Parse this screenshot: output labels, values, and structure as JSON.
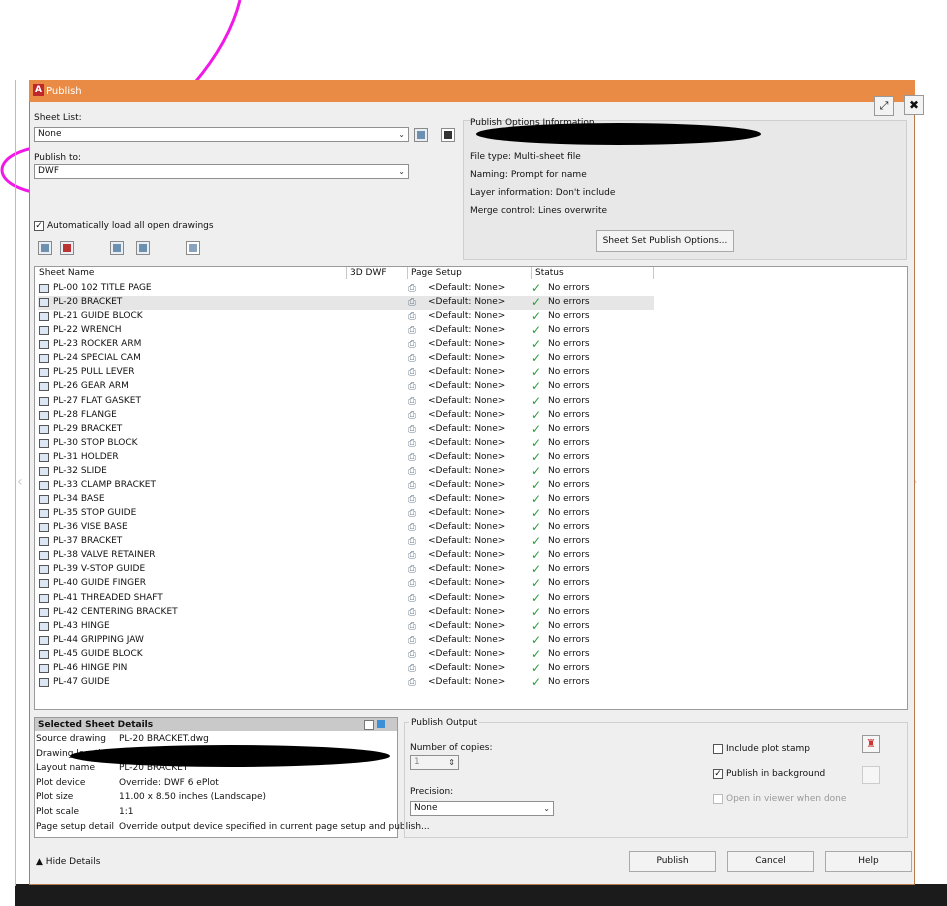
{
  "window": {
    "title": "Publish",
    "app_icon": "A"
  },
  "sheet_list": {
    "label": "Sheet List:",
    "value": "None"
  },
  "publish_to": {
    "label": "Publish to:",
    "value": "DWF"
  },
  "auto_load": {
    "label": "Automatically load all open drawings",
    "checked": true
  },
  "options_info": {
    "heading": "Publish Options Information",
    "lines": [
      "File type: Multi-sheet file",
      "Naming: Prompt for name",
      "Layer information: Don't include",
      "Merge control: Lines overwrite"
    ],
    "button": "Sheet Set Publish Options..."
  },
  "table": {
    "headers": [
      "Sheet Name",
      "3D DWF",
      "Page Setup",
      "Status"
    ],
    "page_setup": "<Default: None>",
    "status": "No errors",
    "rows": [
      "PL-00 102 TITLE PAGE",
      "PL-20 BRACKET",
      "PL-21 GUIDE BLOCK",
      "PL-22 WRENCH",
      "PL-23 ROCKER ARM",
      "PL-24 SPECIAL CAM",
      "PL-25 PULL LEVER",
      "PL-26 GEAR ARM",
      "PL-27 FLAT GASKET",
      "PL-28 FLANGE",
      "PL-29 BRACKET",
      "PL-30 STOP BLOCK",
      "PL-31 HOLDER",
      "PL-32 SLIDE",
      "PL-33 CLAMP BRACKET",
      "PL-34 BASE",
      "PL-35 STOP GUIDE",
      "PL-36 VISE BASE",
      "PL-37 BRACKET",
      "PL-38 VALVE RETAINER",
      "PL-39 V-STOP GUIDE",
      "PL-40 GUIDE FINGER",
      "PL-41 THREADED SHAFT",
      "PL-42 CENTERING BRACKET",
      "PL-43 HINGE",
      "PL-44 GRIPPING JAW",
      "PL-45 GUIDE BLOCK",
      "PL-46 HINGE PIN",
      "PL-47 GUIDE"
    ],
    "selected_index": 1
  },
  "details": {
    "heading": "Selected Sheet Details",
    "fields": [
      {
        "k": "Source drawing",
        "v": "PL-20 BRACKET.dwg"
      },
      {
        "k": "Drawing location",
        "v": ""
      },
      {
        "k": "Layout name",
        "v": "PL-20 BRACKET"
      },
      {
        "k": "Plot device",
        "v": "Override: DWF 6 ePlot"
      },
      {
        "k": "Plot size",
        "v": "11.00 x 8.50 inches (Landscape)"
      },
      {
        "k": "Plot scale",
        "v": "1:1"
      },
      {
        "k": "Page setup detail",
        "v": "Override output device specified in current page setup and publish..."
      }
    ]
  },
  "output": {
    "heading": "Publish Output",
    "copies_label": "Number of copies:",
    "copies": "1",
    "precision_label": "Precision:",
    "precision": "None",
    "include_plot_stamp": "Include plot stamp",
    "publish_in_background": "Publish in background",
    "open_in_viewer": "Open in viewer when done"
  },
  "footer": {
    "hide_details": "Hide Details",
    "publish": "Publish",
    "cancel": "Cancel",
    "help": "Help"
  }
}
